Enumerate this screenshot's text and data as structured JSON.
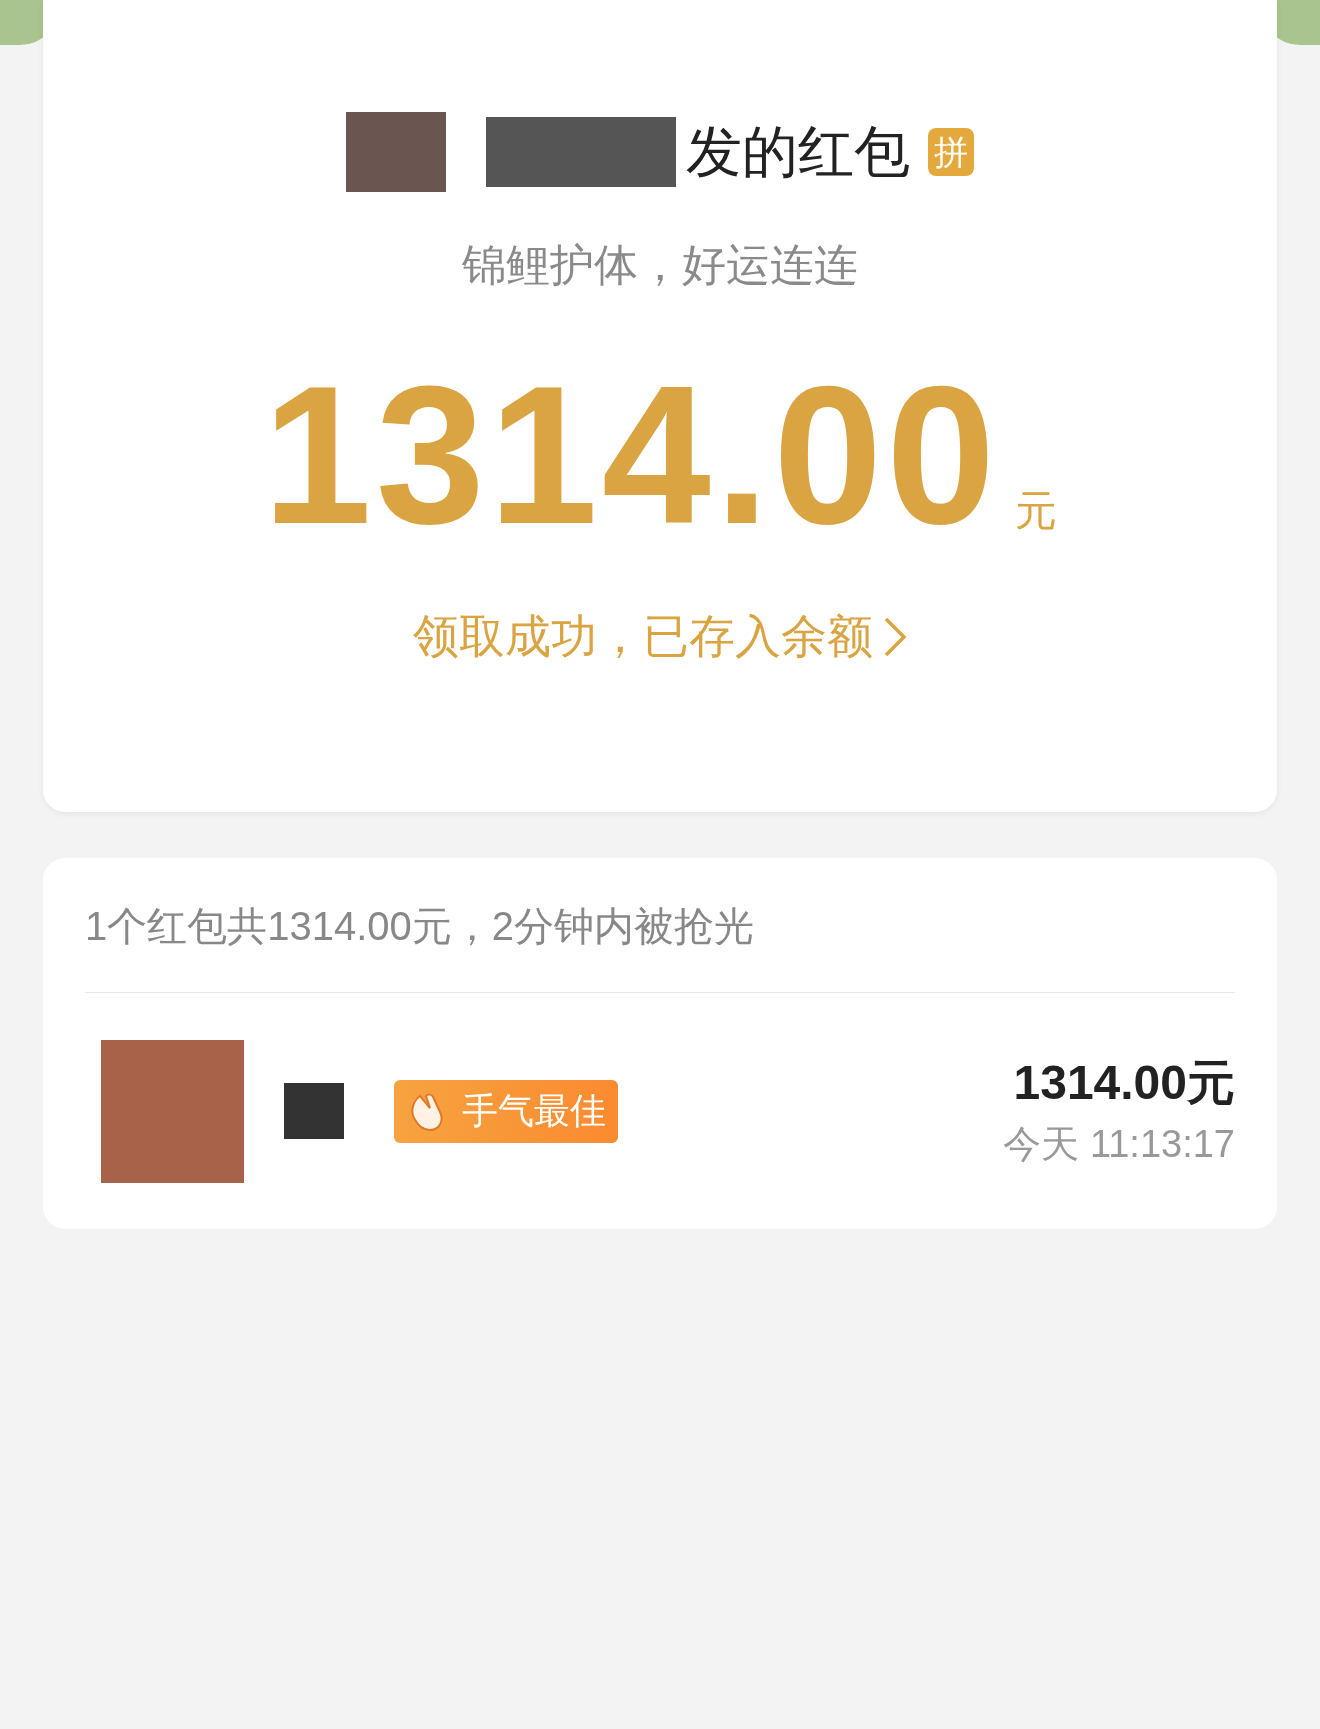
{
  "packet": {
    "title": "发的红包",
    "badge": "拼",
    "wish": "锦鲤护体，好运连连",
    "amount": "1314.00",
    "unit": "元",
    "status": "领取成功，已存入余额"
  },
  "summary": "1个红包共1314.00元，2分钟内被抢光",
  "receivers": [
    {
      "best": true,
      "best_label": "手气最佳",
      "amount": "1314.00元",
      "time": "今天 11:13:17"
    }
  ]
}
